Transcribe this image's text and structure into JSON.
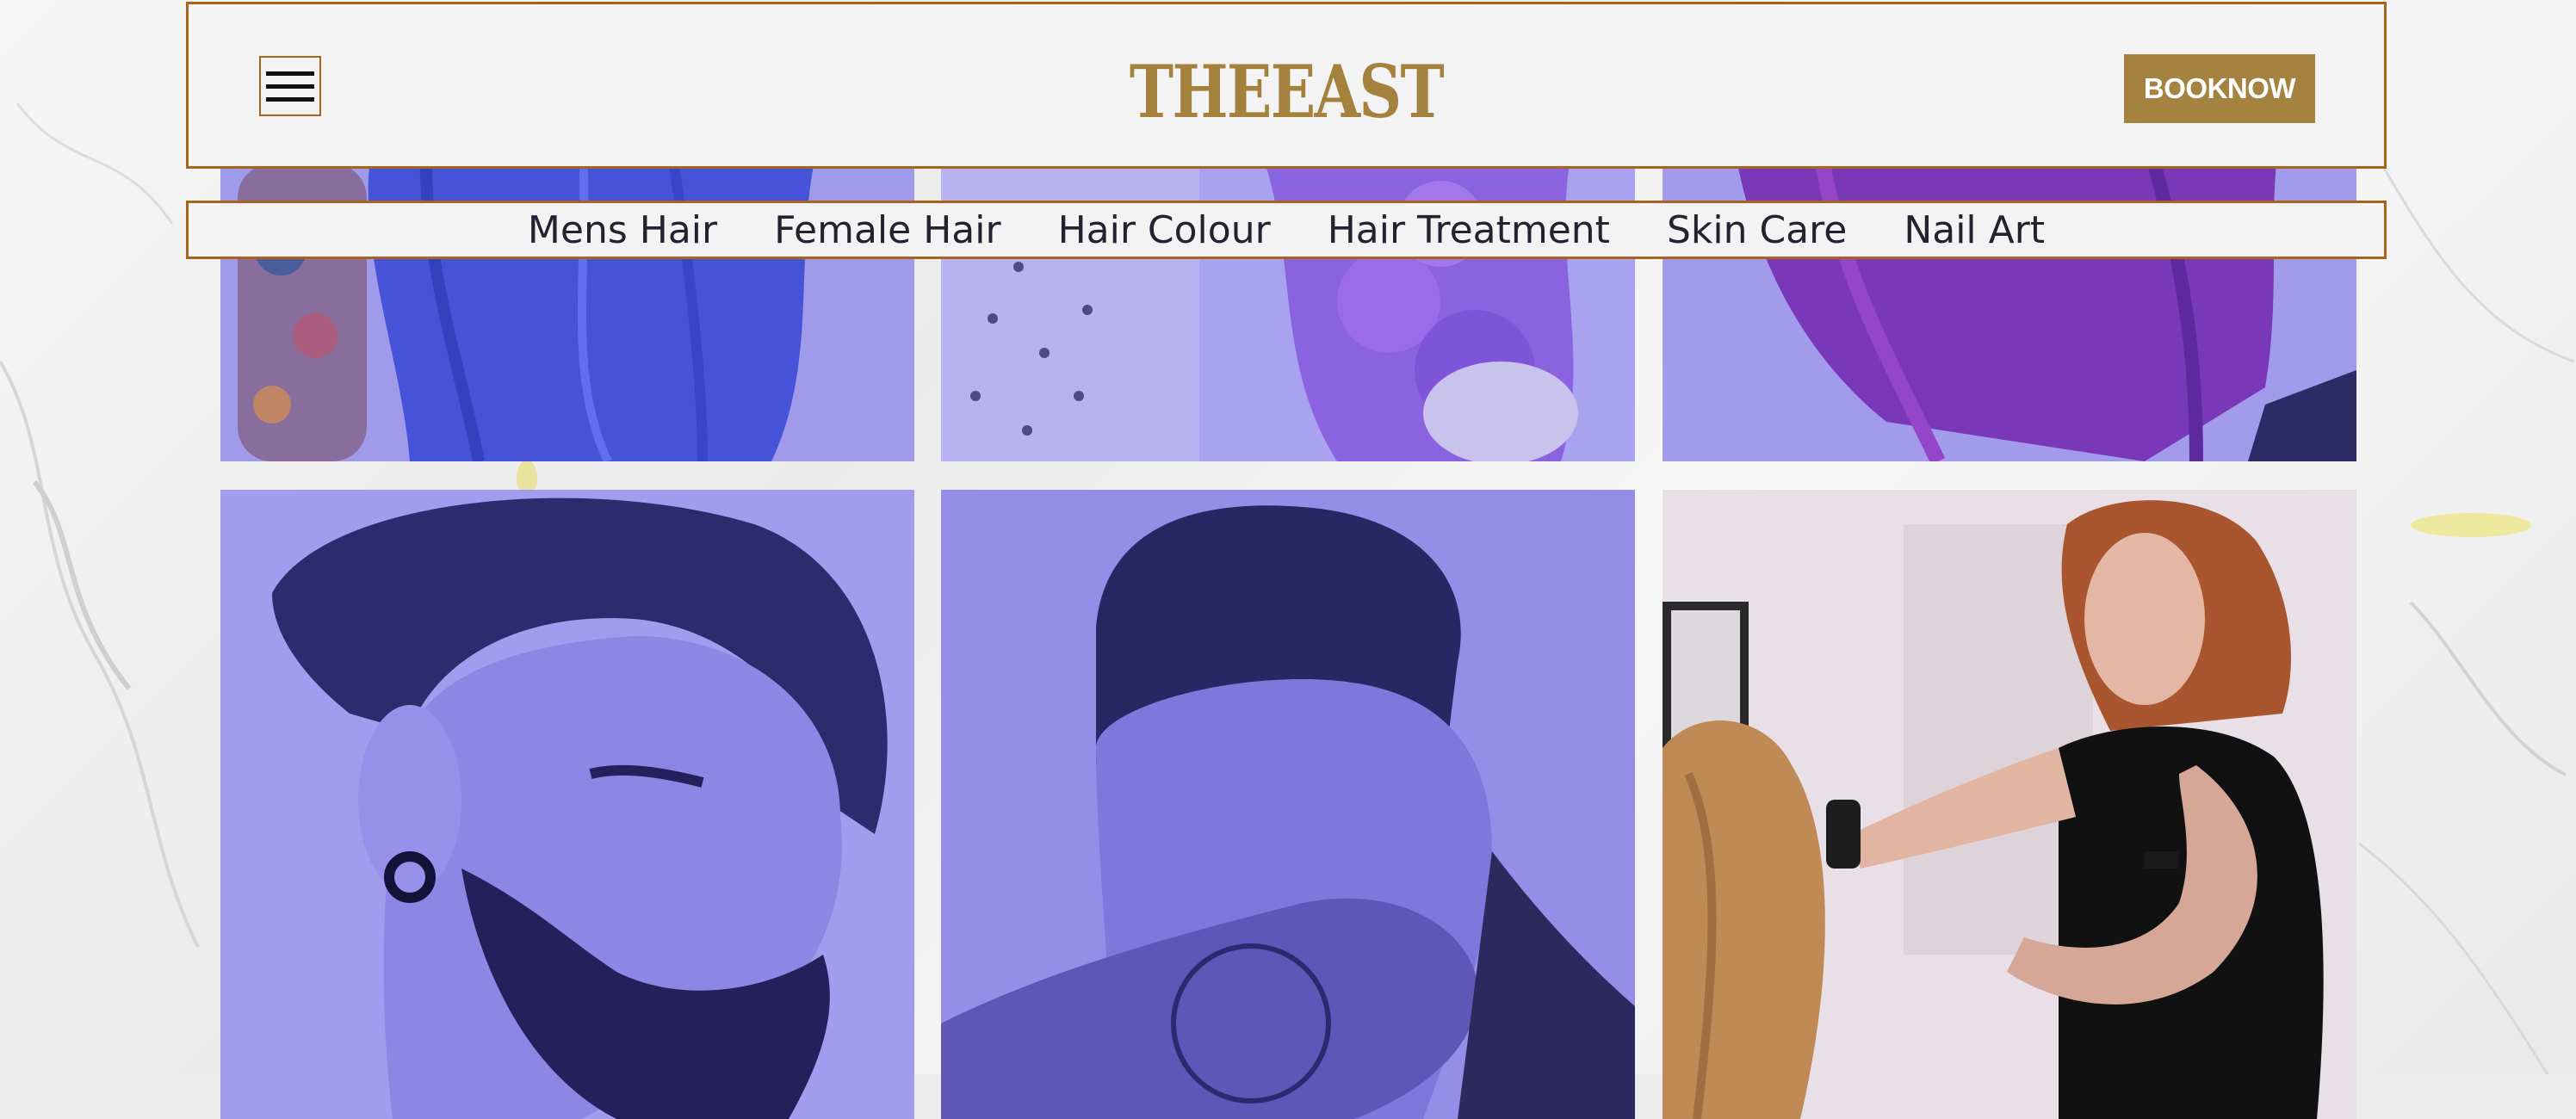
{
  "header": {
    "logo_text": "THEEAST",
    "book_button_label": "BOOKNOW",
    "menu_icon": "hamburger-menu-icon"
  },
  "nav": {
    "items": [
      {
        "label": "Mens Hair"
      },
      {
        "label": "Female Hair"
      },
      {
        "label": "Hair Colour"
      },
      {
        "label": "Hair Treatment"
      },
      {
        "label": "Skin Care"
      },
      {
        "label": "Nail Art"
      }
    ]
  },
  "gallery": {
    "tiles": [
      {
        "subject": "blue-wavy-hair-tattooed-arm"
      },
      {
        "subject": "purple-curly-hair"
      },
      {
        "subject": "magenta-straight-hair"
      },
      {
        "subject": "man-undercut-beard-ear-tunnel"
      },
      {
        "subject": "man-skin-fade-tattooed-hand"
      },
      {
        "subject": "stylist-curling-client-hair"
      }
    ]
  },
  "colors": {
    "gold_brand": "#a4823f",
    "border_accent": "#a8631c",
    "overlay_purple": "#7a6ee8",
    "nav_text": "#222230"
  }
}
